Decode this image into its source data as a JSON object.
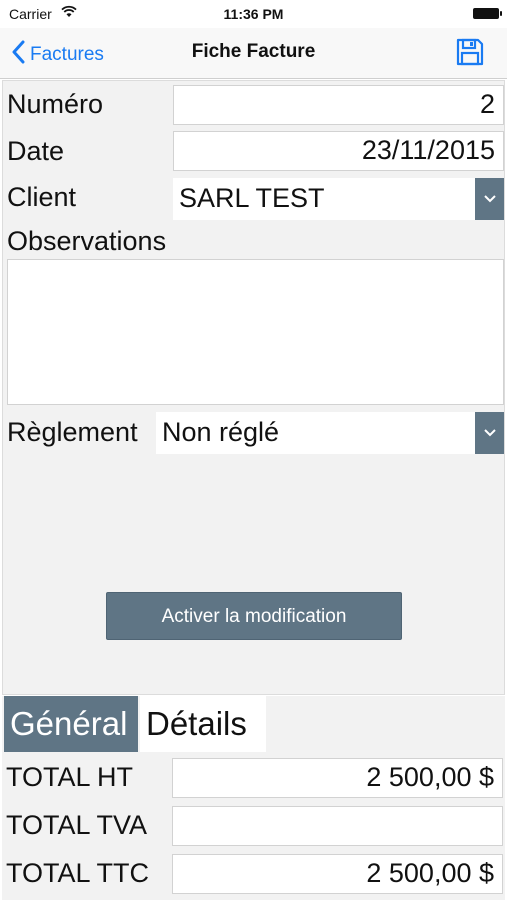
{
  "status_bar": {
    "carrier": "Carrier",
    "time": "11:36 PM"
  },
  "nav": {
    "back_label": "Factures",
    "title": "Fiche Facture",
    "save_icon": "save-icon"
  },
  "form": {
    "numero_label": "Numéro",
    "numero_value": "2",
    "date_label": "Date",
    "date_value": "23/11/2015",
    "client_label": "Client",
    "client_value": "SARL TEST",
    "observations_label": "Observations",
    "observations_value": "",
    "reglement_label": "Règlement",
    "reglement_value": "Non réglé",
    "activate_button": "Activer la modification"
  },
  "tabs": [
    {
      "label": "Général",
      "active": true
    },
    {
      "label": "Détails",
      "active": false
    }
  ],
  "totals": {
    "ht_label": "TOTAL HT",
    "ht_value": "2 500,00 $",
    "tva_label": "TOTAL TVA",
    "tva_value": "",
    "ttc_label": "TOTAL TTC",
    "ttc_value": "2 500,00 $"
  },
  "colors": {
    "accent": "#1a7bf2",
    "control": "#5f7585",
    "panel": "#f2f2f2"
  }
}
